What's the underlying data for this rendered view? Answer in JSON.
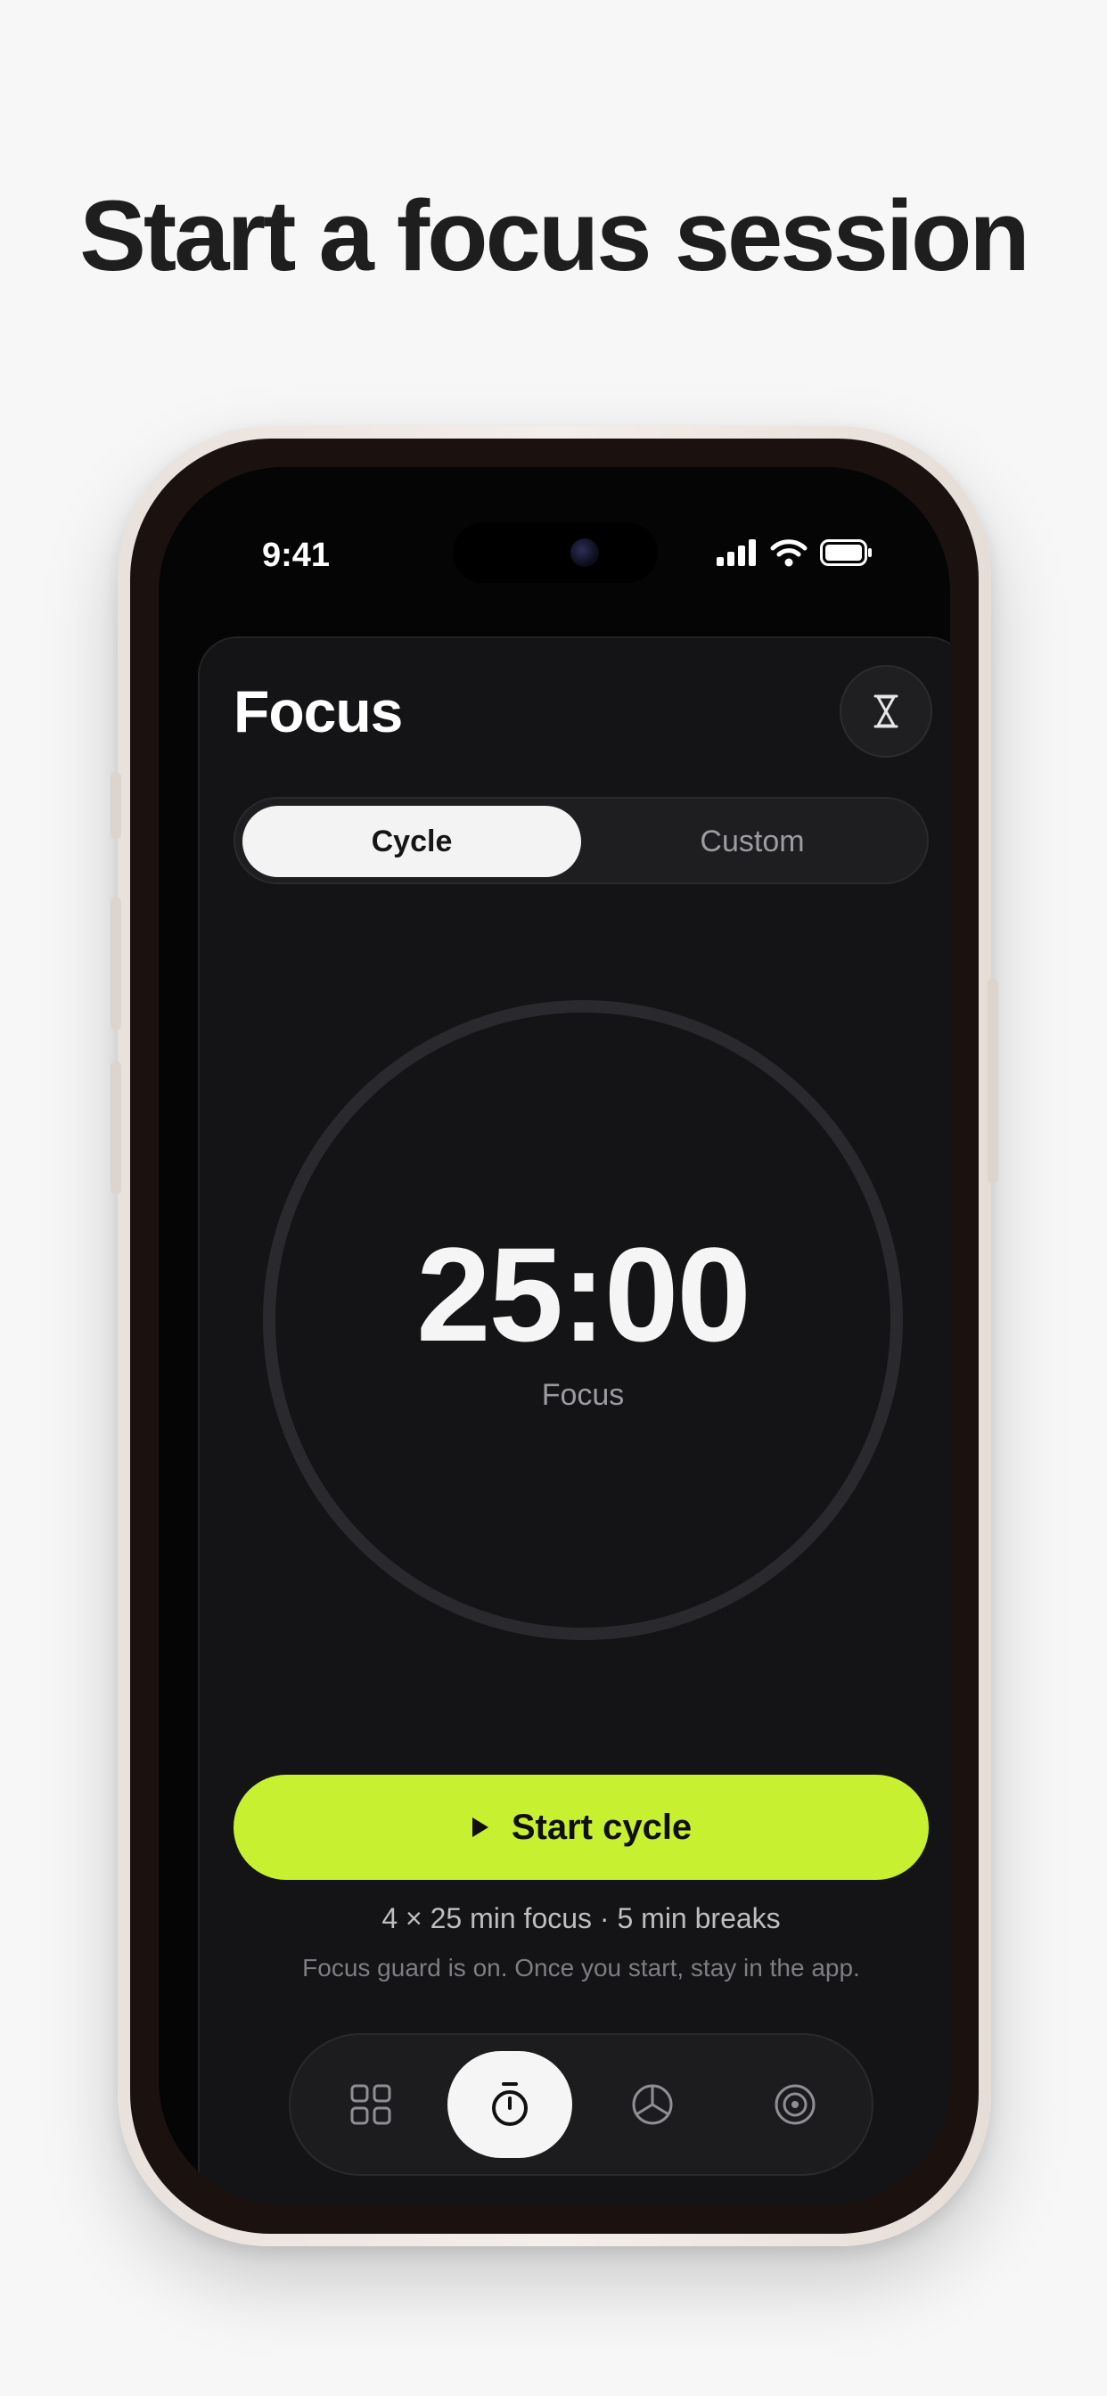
{
  "headline": "Start a focus session",
  "status_bar": {
    "time": "9:41",
    "icons": [
      "signal-icon",
      "wifi-icon",
      "battery-icon"
    ]
  },
  "app": {
    "title": "Focus",
    "timer_icon": "hourglass-icon",
    "mode_toggle": {
      "options": [
        "Cycle",
        "Custom"
      ],
      "selected": "Cycle"
    },
    "timer": {
      "time": "25:00",
      "label": "Focus",
      "progress": 0
    },
    "start_button": {
      "icon": "play-icon",
      "label": "Start cycle"
    },
    "summary": "4 × 25 min focus · 5 min breaks",
    "guard_note": "Focus guard is on. Once you start, stay in the app.",
    "tabbar": {
      "items": [
        {
          "icon": "grid-icon",
          "active": false
        },
        {
          "icon": "stopwatch-icon",
          "active": true
        },
        {
          "icon": "pie-chart-icon",
          "active": false
        },
        {
          "icon": "target-icon",
          "active": false
        }
      ]
    }
  },
  "colors": {
    "page_background": "#f7f7f7",
    "screen_background": "#050505",
    "card_background": "#141416",
    "accent": "#c7f031",
    "ring": "#2a2a2e",
    "text_primary": "#f5f5f5",
    "text_secondary": "#9a9aa0"
  }
}
